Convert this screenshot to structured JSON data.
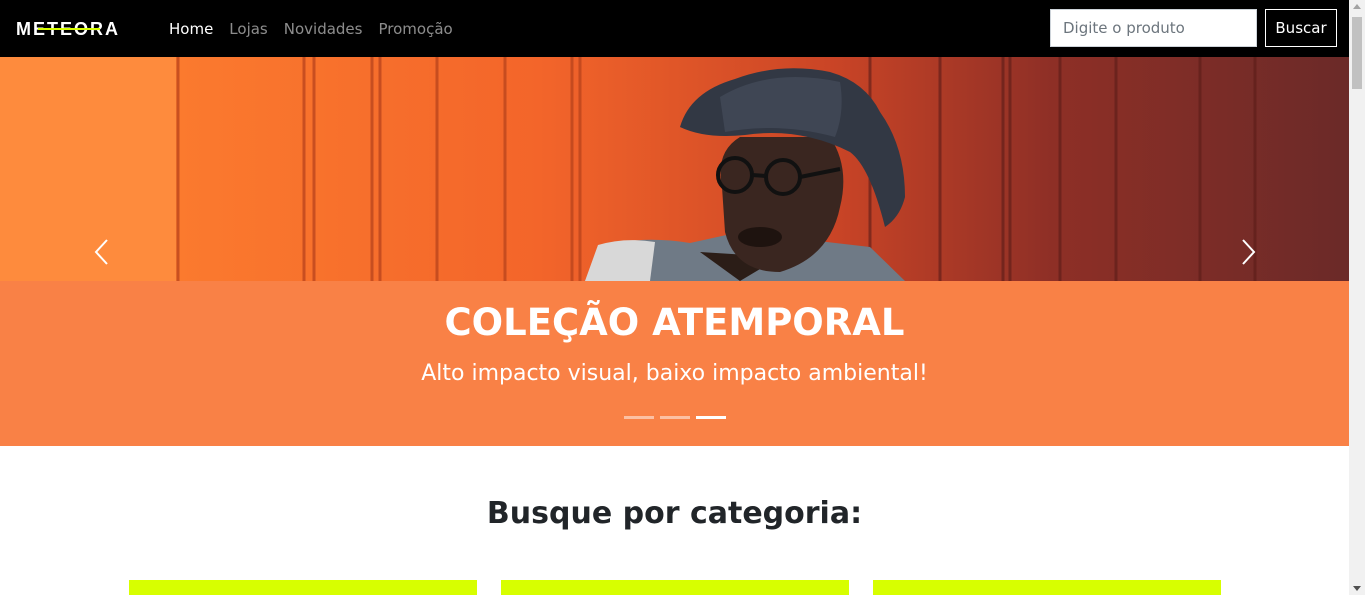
{
  "brand": {
    "name": "METEORA",
    "accent_color": "#d7ff00"
  },
  "nav": {
    "links": [
      {
        "label": "Home",
        "active": true
      },
      {
        "label": "Lojas",
        "active": false
      },
      {
        "label": "Novidades",
        "active": false
      },
      {
        "label": "Promoção",
        "active": false
      }
    ]
  },
  "search": {
    "placeholder": "Digite o produto",
    "value": "",
    "button_label": "Buscar"
  },
  "carousel": {
    "title": "COLEÇÃO ATEMPORAL",
    "subtitle": "Alto impacto visual, baixo impacto ambiental!",
    "slide_count": 3,
    "active_slide": 3,
    "background_color": "#f98146",
    "prev_icon": "chevron-left-icon",
    "next_icon": "chevron-right-icon"
  },
  "categories": {
    "heading": "Busque por categoria:",
    "tile_color": "#d7ff00",
    "visible_tiles": 3
  }
}
